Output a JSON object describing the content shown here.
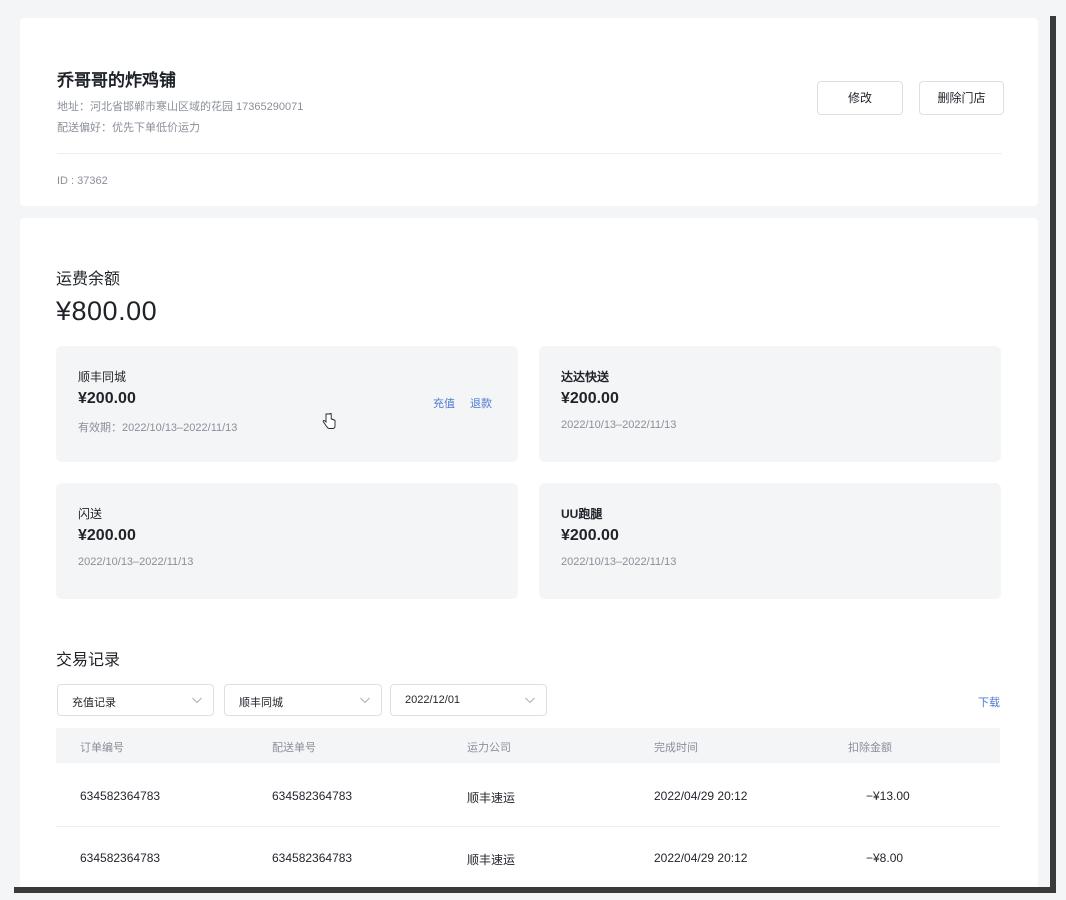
{
  "store": {
    "name": "乔哥哥的炸鸡铺",
    "address": "地址：河北省邯郸市寒山区域的花园 17365290071",
    "delivery_pref": "配送偏好：优先下单低价运力",
    "id_text": "ID : 37362",
    "edit_label": "修改",
    "delete_label": "删除门店"
  },
  "balance": {
    "title": "运费余额",
    "amount": "¥800.00"
  },
  "carriers": [
    {
      "name": "顺丰同城",
      "amount": "¥200.00",
      "validity": "有效期：2022/10/13–2022/11/13",
      "recharge_label": "充值",
      "refund_label": "退款"
    },
    {
      "name": "达达快送",
      "amount": "¥200.00",
      "validity": "2022/10/13–2022/11/13"
    },
    {
      "name": "闪送",
      "amount": "¥200.00",
      "validity": "2022/10/13–2022/11/13"
    },
    {
      "name": "UU跑腿",
      "amount": "¥200.00",
      "validity": "2022/10/13–2022/11/13"
    }
  ],
  "transactions": {
    "title": "交易记录",
    "filters": {
      "type": "充值记录",
      "carrier": "顺丰同城",
      "date": "2022/12/01"
    },
    "download_label": "下载",
    "columns": [
      "订单编号",
      "配送单号",
      "运力公司",
      "完成时间",
      "扣除金额"
    ],
    "rows": [
      [
        "634582364783",
        "634582364783",
        "顺丰速运",
        "2022/04/29 20:12",
        "−¥13.00"
      ],
      [
        "634582364783",
        "634582364783",
        "顺丰速运",
        "2022/04/29 20:12",
        "−¥8.00"
      ]
    ]
  },
  "colors": {
    "link": "#4e7ad0",
    "muted_text": "#8a8f99",
    "card_bg": "#f4f5f7"
  }
}
